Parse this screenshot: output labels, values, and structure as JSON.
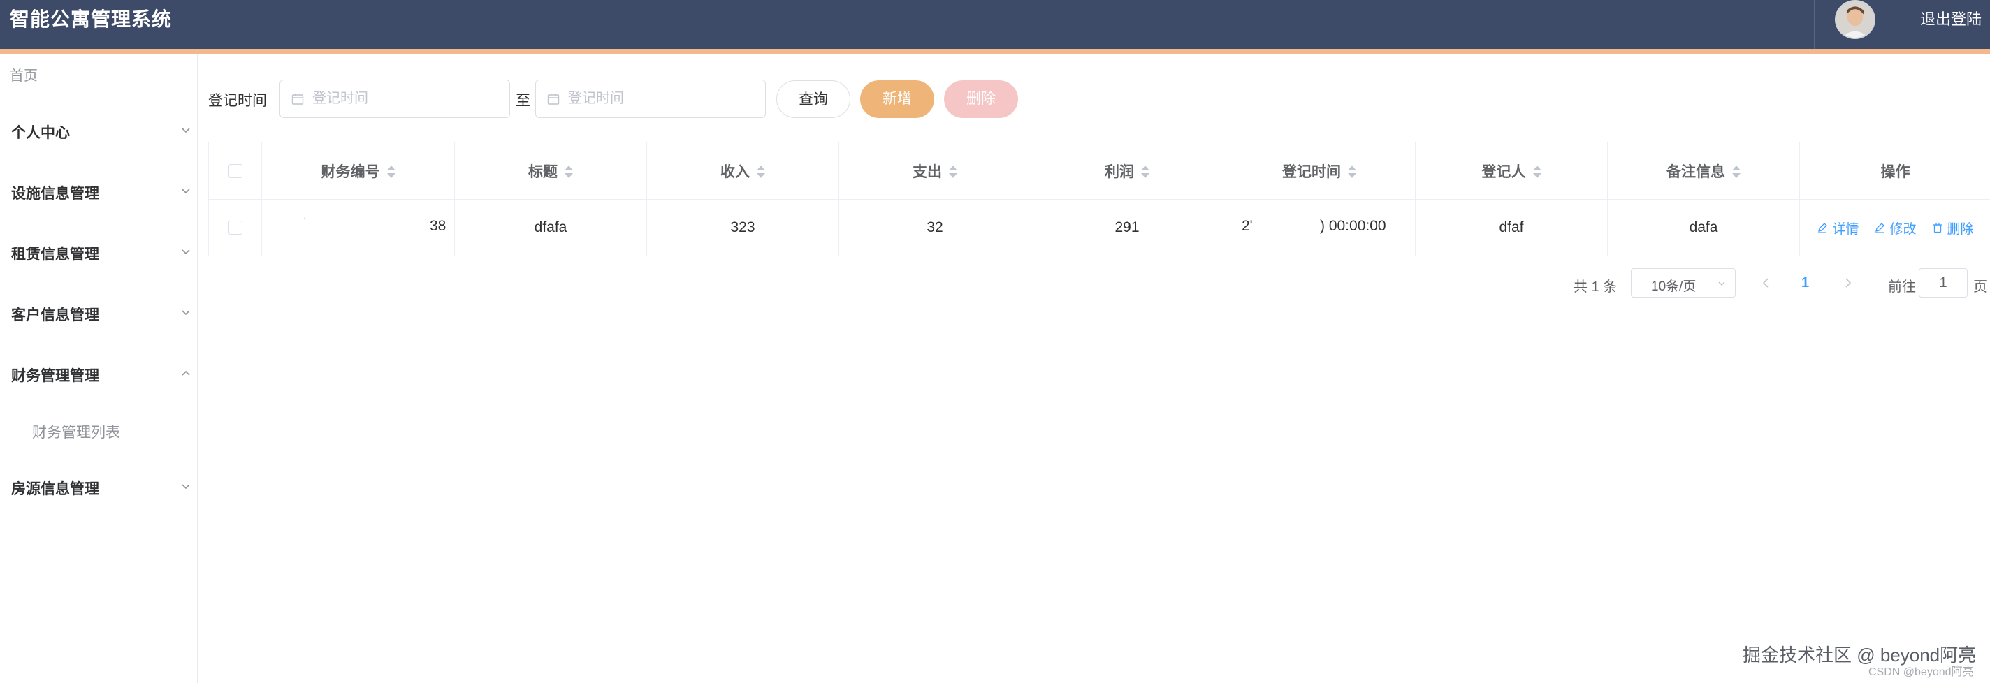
{
  "header": {
    "app_title": "智能公寓管理系统",
    "logout_label": "退出登陆"
  },
  "sidebar": {
    "home": "首页",
    "menus": [
      {
        "label": "个人中心",
        "expanded": false
      },
      {
        "label": "设施信息管理",
        "expanded": false
      },
      {
        "label": "租赁信息管理",
        "expanded": false
      },
      {
        "label": "客户信息管理",
        "expanded": false
      },
      {
        "label": "财务管理管理",
        "expanded": true
      },
      {
        "label": "房源信息管理",
        "expanded": false
      }
    ],
    "submenu_item": "财务管理列表"
  },
  "search": {
    "label": "登记时间",
    "start_placeholder": "登记时间",
    "to_label": "至",
    "end_placeholder": "登记时间",
    "query_label": "查询",
    "add_label": "新增",
    "delete_label": "删除"
  },
  "table": {
    "columns": [
      "财务编号",
      "标题",
      "收入",
      "支出",
      "利润",
      "登记时间",
      "登记人",
      "备注信息",
      "操作"
    ],
    "rows": [
      {
        "id_fragment_a": "'",
        "id_fragment_b": "38",
        "title": "dfafa",
        "income": "323",
        "expense": "32",
        "profit": "291",
        "time_fragment_a": "2'",
        "time_fragment_b": ") 00:00:00",
        "registrant": "dfaf",
        "remark": "dafa",
        "actions": {
          "detail": "详情",
          "edit": "修改",
          "delete": "删除"
        }
      }
    ]
  },
  "pagination": {
    "total_text": "共 1 条",
    "page_size": "10条/页",
    "current_page": "1",
    "goto_label": "前往",
    "goto_value": "1",
    "page_suffix": "页"
  },
  "watermark": {
    "line1": "掘金技术社区 @ beyond阿亮",
    "line2": "CSDN @beyond阿亮"
  },
  "colors": {
    "header_bg": "#3d4a68",
    "accent": "#f3b98c",
    "add_button": "#efb478",
    "delete_button": "#f6c6c6",
    "link": "#409eff"
  }
}
